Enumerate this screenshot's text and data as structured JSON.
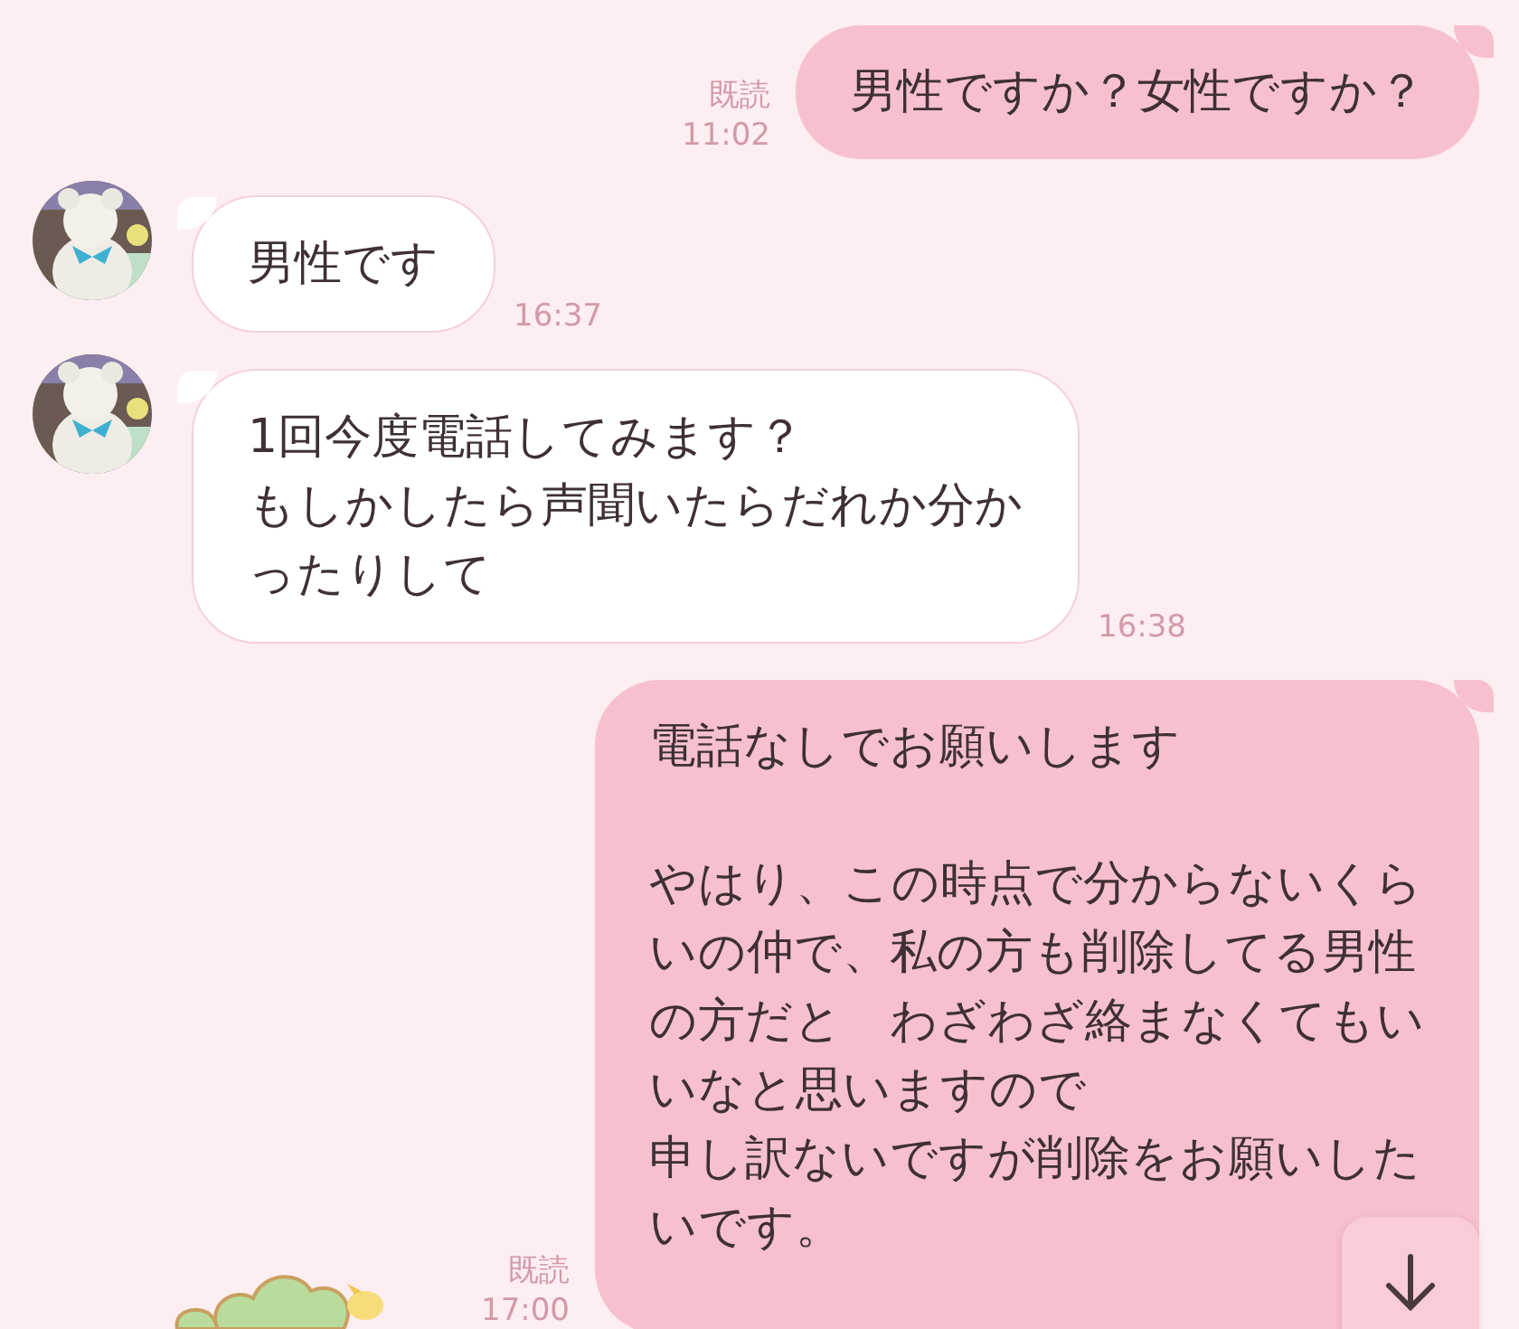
{
  "messages": [
    {
      "kind": "sent",
      "read_label": "既読",
      "time": "11:02",
      "paragraphs": [
        [
          "男性ですか？女性ですか？"
        ]
      ]
    },
    {
      "kind": "received",
      "avatar": {
        "kind": "picture"
      },
      "time": "16:37",
      "paragraphs": [
        [
          "男性です"
        ]
      ]
    },
    {
      "kind": "received",
      "avatar": {
        "kind": "picture"
      },
      "time": "16:38",
      "paragraphs": [
        [
          "1回今度電話してみます？",
          "もしかしたら声聞いたらだれか分か",
          "ったりして"
        ]
      ]
    },
    {
      "kind": "sent",
      "read_label": "既読",
      "time": "17:00",
      "paragraphs": [
        [
          "電話なしでお願いします"
        ],
        [
          "やはり、この時点で分からないくら",
          "いの仲で、私の方も削除してる男性",
          "の方だと　わざわざ絡まなくてもい",
          "いなと思いますので",
          "申し訳ないですが削除をお願いした",
          "いです。"
        ]
      ]
    }
  ]
}
